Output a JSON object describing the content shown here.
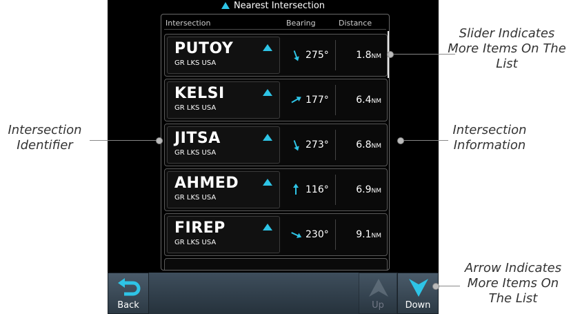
{
  "title": "Nearest Intersection",
  "columns": {
    "intersection": "Intersection",
    "bearing": "Bearing",
    "distance": "Distance"
  },
  "rows": [
    {
      "ident": "PUTOY",
      "region": "GR LKS USA",
      "bearing": "275°",
      "distance": "1.8",
      "unit": "NM",
      "arrow_deg": 160
    },
    {
      "ident": "KELSI",
      "region": "GR LKS USA",
      "bearing": "177°",
      "distance": "6.4",
      "unit": "NM",
      "arrow_deg": 60
    },
    {
      "ident": "JITSA",
      "region": "GR LKS USA",
      "bearing": "273°",
      "distance": "6.8",
      "unit": "NM",
      "arrow_deg": 160
    },
    {
      "ident": "AHMED",
      "region": "GR LKS USA",
      "bearing": "116°",
      "distance": "6.9",
      "unit": "NM",
      "arrow_deg": 0
    },
    {
      "ident": "FIREP",
      "region": "GR LKS USA",
      "bearing": "230°",
      "distance": "9.1",
      "unit": "NM",
      "arrow_deg": 115
    }
  ],
  "buttons": {
    "back": "Back",
    "up": "Up",
    "down": "Down"
  },
  "callouts": {
    "slider": "Slider Indicates More Items On The List",
    "identifier": "Intersection Identifier",
    "information": "Intersection Information",
    "arrow": "Arrow Indicates More Items On The List"
  },
  "colors": {
    "accent": "#2ec4e6",
    "background": "#000000",
    "text": "#ffffff"
  }
}
